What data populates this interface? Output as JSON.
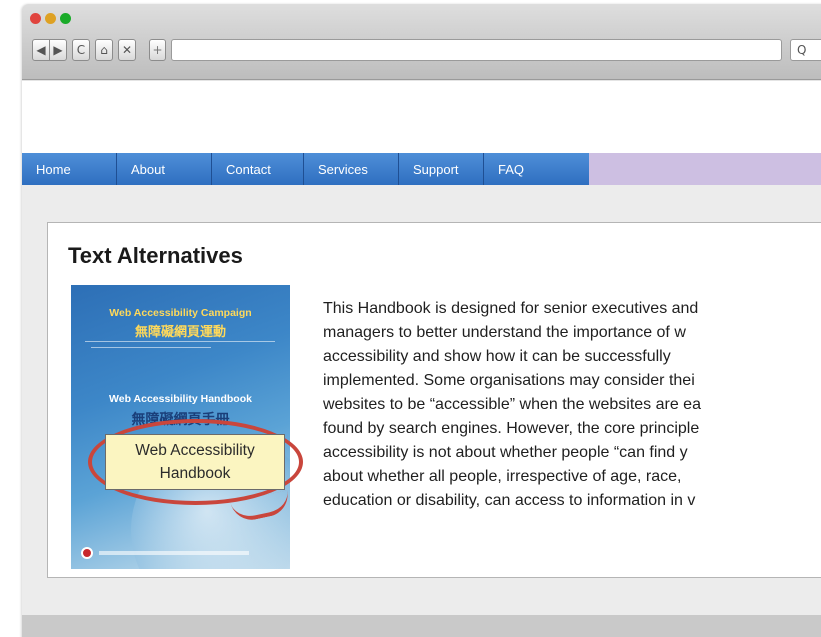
{
  "browser": {
    "buttons": {
      "back": "◀",
      "forward": "▶",
      "reload": "C",
      "home": "⌂",
      "stop": "✕",
      "new_tab": "+",
      "search": "Q"
    },
    "url": ""
  },
  "nav": {
    "items": [
      "Home",
      "About",
      "Contact",
      "Services",
      "Support",
      "FAQ"
    ]
  },
  "section": {
    "title": "Text Alternatives"
  },
  "cover": {
    "line1": "Web Accessibility Campaign",
    "line2": "無障礙網頁運動",
    "line3": "Web Accessibility Handbook",
    "line4": "無障礙網頁手冊"
  },
  "callout": {
    "line1": "Web Accessibility",
    "line2": "Handbook"
  },
  "description": {
    "lines": [
      "This Handbook is designed for senior executives and",
      "managers to better understand the importance of w",
      "accessibility and show how it can be successfully",
      "implemented. Some organisations may consider thei",
      "websites to be “accessible” when the websites are ea",
      "found by search engines. However, the core principle",
      "accessibility is not about whether people “can find y",
      "about whether all people, irrespective of age, race,",
      "education or disability, can access to information in v"
    ]
  },
  "colors": {
    "nav_blue": "#3a7bcc",
    "nav_lavender": "#cdbfe2",
    "callout_red": "#c9463c",
    "callout_fill": "#fbf5c1"
  }
}
